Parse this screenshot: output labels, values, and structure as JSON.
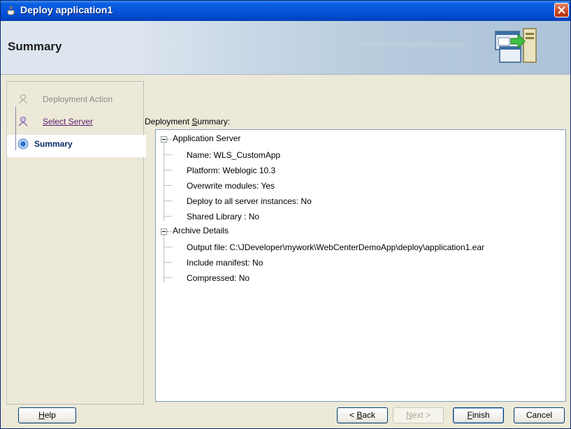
{
  "window": {
    "title": "Deploy application1"
  },
  "banner": {
    "title": "Summary",
    "bits": "0101010101010101010101010101"
  },
  "steps": [
    {
      "label": "Deployment Action",
      "state": "done"
    },
    {
      "label": "Select Server",
      "state": "link"
    },
    {
      "label": "Summary",
      "state": "current"
    }
  ],
  "summary": {
    "label_pre": "Deployment ",
    "label_mnemonic": "S",
    "label_post": "ummary:",
    "application_server": {
      "label": "Application Server",
      "items": [
        "Name:  WLS_CustomApp",
        "Platform: Weblogic 10.3",
        "Overwrite modules: Yes",
        "Deploy to all server instances: No",
        "Shared Library : No"
      ]
    },
    "archive_details": {
      "label": "Archive Details",
      "items": [
        "Output file: C:\\JDeveloper\\mywork\\WebCenterDemoApp\\deploy\\application1.ear",
        "Include manifest: No",
        "Compressed: No"
      ]
    }
  },
  "buttons": {
    "help_m": "H",
    "help_rest": "elp",
    "back_pre": "< ",
    "back_m": "B",
    "back_rest": "ack",
    "next_m": "N",
    "next_rest": "ext >",
    "finish_m": "F",
    "finish_rest": "inish",
    "cancel": "Cancel"
  },
  "colors": {
    "title_bar": "#0855dd",
    "link": "#5b1b6e",
    "current_step": "#0a2a6a"
  }
}
